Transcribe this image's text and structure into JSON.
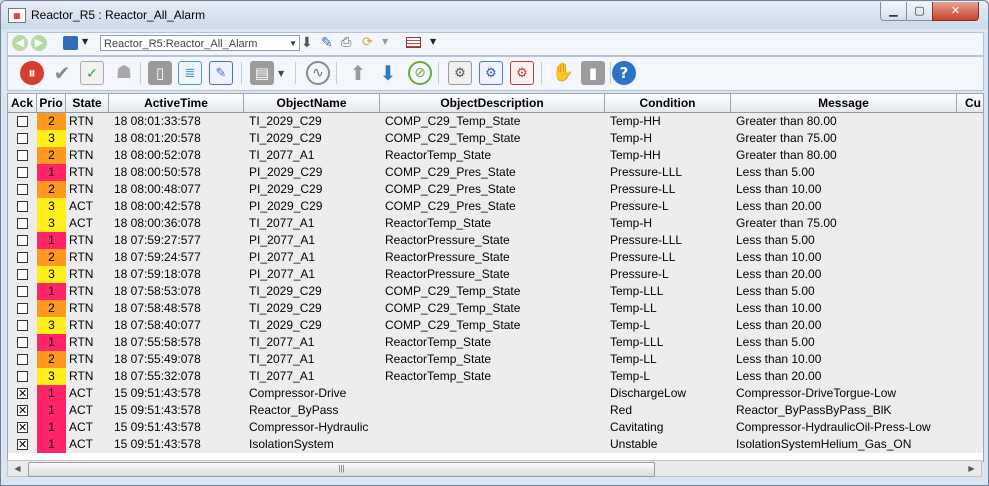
{
  "window": {
    "title": "Reactor_R5 : Reactor_All_Alarm"
  },
  "toolbar": {
    "path_combo": "Reactor_R5:Reactor_All_Alarm"
  },
  "grid": {
    "columns": [
      "Ack",
      "Prio",
      "State",
      "ActiveTime",
      "ObjectName",
      "ObjectDescription",
      "Condition",
      "Message",
      "Cu"
    ],
    "rows": [
      {
        "ack": false,
        "prio": "2",
        "state": "RTN",
        "time": "18 08:01:33:578",
        "name": "TI_2029_C29",
        "desc": "COMP_C29_Temp_State",
        "cond": "Temp-HH",
        "msg": "Greater than 80.00"
      },
      {
        "ack": false,
        "prio": "3",
        "state": "RTN",
        "time": "18 08:01:20:578",
        "name": "TI_2029_C29",
        "desc": "COMP_C29_Temp_State",
        "cond": "Temp-H",
        "msg": "Greater than 75.00"
      },
      {
        "ack": false,
        "prio": "2",
        "state": "RTN",
        "time": "18 08:00:52:078",
        "name": "TI_2077_A1",
        "desc": "ReactorTemp_State",
        "cond": "Temp-HH",
        "msg": "Greater than 80.00"
      },
      {
        "ack": false,
        "prio": "1",
        "state": "RTN",
        "time": "18 08:00:50:578",
        "name": "PI_2029_C29",
        "desc": "COMP_C29_Pres_State",
        "cond": "Pressure-LLL",
        "msg": "Less than  5.00"
      },
      {
        "ack": false,
        "prio": "2",
        "state": "RTN",
        "time": "18 08:00:48:077",
        "name": "PI_2029_C29",
        "desc": "COMP_C29_Pres_State",
        "cond": "Pressure-LL",
        "msg": "Less than 10.00"
      },
      {
        "ack": false,
        "prio": "3",
        "state": "ACT",
        "time": "18 08:00:42:578",
        "name": "PI_2029_C29",
        "desc": "COMP_C29_Pres_State",
        "cond": "Pressure-L",
        "msg": "Less than 20.00"
      },
      {
        "ack": false,
        "prio": "3",
        "state": "ACT",
        "time": "18 08:00:36:078",
        "name": "TI_2077_A1",
        "desc": "ReactorTemp_State",
        "cond": "Temp-H",
        "msg": "Greater than 75.00"
      },
      {
        "ack": false,
        "prio": "1",
        "state": "RTN",
        "time": "18 07:59:27:577",
        "name": "PI_2077_A1",
        "desc": "ReactorPressure_State",
        "cond": "Pressure-LLL",
        "msg": "Less than  5.00"
      },
      {
        "ack": false,
        "prio": "2",
        "state": "RTN",
        "time": "18 07:59:24:577",
        "name": "PI_2077_A1",
        "desc": "ReactorPressure_State",
        "cond": "Pressure-LL",
        "msg": "Less than 10.00"
      },
      {
        "ack": false,
        "prio": "3",
        "state": "RTN",
        "time": "18 07:59:18:078",
        "name": "PI_2077_A1",
        "desc": "ReactorPressure_State",
        "cond": "Pressure-L",
        "msg": "Less than 20.00"
      },
      {
        "ack": false,
        "prio": "1",
        "state": "RTN",
        "time": "18 07:58:53:078",
        "name": "TI_2029_C29",
        "desc": "COMP_C29_Temp_State",
        "cond": "Temp-LLL",
        "msg": "Less than  5.00"
      },
      {
        "ack": false,
        "prio": "2",
        "state": "RTN",
        "time": "18 07:58:48:578",
        "name": "TI_2029_C29",
        "desc": "COMP_C29_Temp_State",
        "cond": "Temp-LL",
        "msg": "Less than 10.00"
      },
      {
        "ack": false,
        "prio": "3",
        "state": "RTN",
        "time": "18 07:58:40:077",
        "name": "TI_2029_C29",
        "desc": "COMP_C29_Temp_State",
        "cond": "Temp-L",
        "msg": "Less than 20.00"
      },
      {
        "ack": false,
        "prio": "1",
        "state": "RTN",
        "time": "18 07:55:58:578",
        "name": "TI_2077_A1",
        "desc": "ReactorTemp_State",
        "cond": "Temp-LLL",
        "msg": "Less than  5.00"
      },
      {
        "ack": false,
        "prio": "2",
        "state": "RTN",
        "time": "18 07:55:49:078",
        "name": "TI_2077_A1",
        "desc": "ReactorTemp_State",
        "cond": "Temp-LL",
        "msg": "Less than 10.00"
      },
      {
        "ack": false,
        "prio": "3",
        "state": "RTN",
        "time": "18 07:55:32:078",
        "name": "TI_2077_A1",
        "desc": "ReactorTemp_State",
        "cond": "Temp-L",
        "msg": "Less than 20.00"
      },
      {
        "ack": true,
        "prio": "1",
        "state": "ACT",
        "time": "15 09:51:43:578",
        "name": "Compressor-Drive",
        "desc": "",
        "cond": "DischargeLow",
        "msg": "Compressor-DriveTorgue-Low"
      },
      {
        "ack": true,
        "prio": "1",
        "state": "ACT",
        "time": "15 09:51:43:578",
        "name": "Reactor_ByPass",
        "desc": "",
        "cond": "Red",
        "msg": "Reactor_ByPassByPass_BlK"
      },
      {
        "ack": true,
        "prio": "1",
        "state": "ACT",
        "time": "15 09:51:43:578",
        "name": "Compressor-Hydraulic",
        "desc": "",
        "cond": "Cavitating",
        "msg": "Compressor-HydraulicOil-Press-Low"
      },
      {
        "ack": true,
        "prio": "1",
        "state": "ACT",
        "time": "15 09:51:43:578",
        "name": "IsolationSystem",
        "desc": "",
        "cond": "Unstable",
        "msg": "IsolationSystemHelium_Gas_ON"
      }
    ]
  },
  "colors": {
    "prio1": "#ff2468",
    "prio2": "#ff9820",
    "prio3": "#ffee1e",
    "row_bg": "#ededed"
  }
}
